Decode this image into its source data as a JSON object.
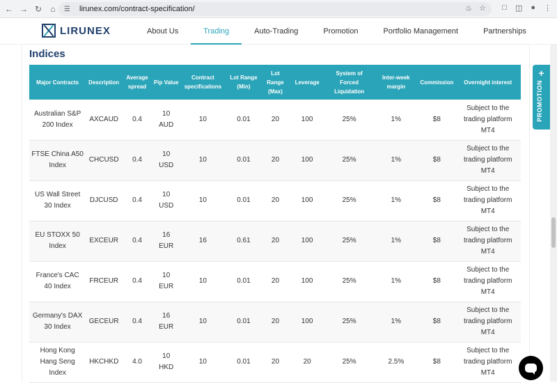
{
  "browser": {
    "url": "lirunex.com/contract-specification/"
  },
  "site": {
    "logo_text": "LIRUNEX",
    "nav": [
      {
        "label": "About Us",
        "active": false
      },
      {
        "label": "Trading",
        "active": true
      },
      {
        "label": "Auto-Trading",
        "active": false
      },
      {
        "label": "Promotion",
        "active": false
      },
      {
        "label": "Portfolio Management",
        "active": false
      },
      {
        "label": "Partnerships",
        "active": false
      }
    ],
    "accent_color": "#2aa4b8",
    "brand_color": "#1e3f6b"
  },
  "section": {
    "title": "Indices"
  },
  "table": {
    "headers": [
      "Major Contracts",
      "Description",
      "Average spread",
      "Pip Value",
      "Contract specifications",
      "Lot Range (Min)",
      "Lot Range (Max)",
      "Leverage",
      "System of Forced Liquidation",
      "Inter-week margin",
      "Commission",
      "Overnight interest"
    ],
    "rows": [
      [
        "Australian S&P 200 Index",
        "AXCAUD",
        "0.4",
        "10 AUD",
        "10",
        "0.01",
        "20",
        "100",
        "25%",
        "1%",
        "$8",
        "Subject to the trading platform MT4"
      ],
      [
        "FTSE China A50 Index",
        "CHCUSD",
        "0.4",
        "10 USD",
        "10",
        "0.01",
        "20",
        "100",
        "25%",
        "1%",
        "$8",
        "Subject to the trading platform MT4"
      ],
      [
        "US Wall Street 30 Index",
        "DJCUSD",
        "0.4",
        "10 USD",
        "10",
        "0.01",
        "20",
        "100",
        "25%",
        "1%",
        "$8",
        "Subject to the trading platform MT4"
      ],
      [
        "EU STOXX 50 Index",
        "EXCEUR",
        "0.4",
        "16 EUR",
        "16",
        "0.61",
        "20",
        "100",
        "25%",
        "1%",
        "$8",
        "Subject to the trading platform MT4"
      ],
      [
        "France's CAC 40 Index",
        "FRCEUR",
        "0.4",
        "10 EUR",
        "10",
        "0.01",
        "20",
        "100",
        "25%",
        "1%",
        "$8",
        "Subject to the trading platform MT4"
      ],
      [
        "Germany's DAX 30 Index",
        "GECEUR",
        "0.4",
        "16 EUR",
        "10",
        "0.01",
        "20",
        "100",
        "25%",
        "1%",
        "$8",
        "Subject to the trading platform MT4"
      ],
      [
        "Hong Kong Hang Seng Index",
        "HKCHKD",
        "4.0",
        "10 HKD",
        "10",
        "0.01",
        "20",
        "20",
        "25%",
        "2.5%",
        "$8",
        "Subject to the trading platform MT4"
      ]
    ]
  },
  "promo_tab": {
    "label": "PROMOTION"
  }
}
